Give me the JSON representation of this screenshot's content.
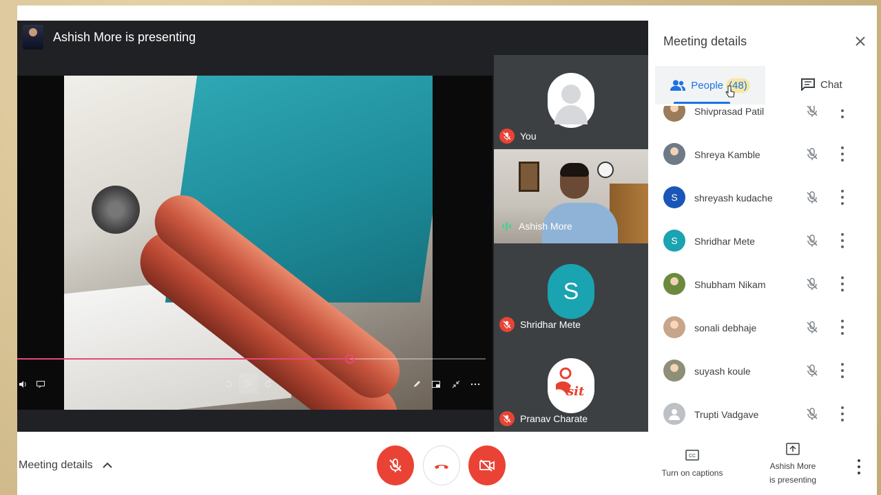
{
  "presentation": {
    "title": "Ashish More is presenting",
    "video": {
      "progress": 0.71
    }
  },
  "tiles": [
    {
      "name": "You",
      "muted": true,
      "type": "placeholder-avatar"
    },
    {
      "name": "Ashish More",
      "muted": false,
      "speaking": true,
      "type": "camera"
    },
    {
      "name": "Shridhar Mete",
      "muted": true,
      "type": "initial",
      "initial": "S",
      "color": "#1aa3b0"
    },
    {
      "name": "Pranav Charate",
      "muted": true,
      "type": "logo",
      "logo_text": "sit"
    }
  ],
  "panel": {
    "title": "Meeting details",
    "tabs": {
      "people_label": "People",
      "people_count": "(48)",
      "chat_label": "Chat"
    },
    "people": [
      {
        "name": "Shivprasad Patil",
        "avatar": "photo",
        "color": "#9a7b5a"
      },
      {
        "name": "Shreya Kamble",
        "avatar": "photo",
        "color": "#6f7a87"
      },
      {
        "name": "shreyash kudache",
        "avatar": "initial",
        "initial": "S",
        "color": "#1a56b8"
      },
      {
        "name": "Shridhar Mete",
        "avatar": "initial",
        "initial": "S",
        "color": "#1aa3b0"
      },
      {
        "name": "Shubham Nikam",
        "avatar": "photo",
        "color": "#6b8a3e"
      },
      {
        "name": "sonali debhaje",
        "avatar": "photo",
        "color": "#c7a58a"
      },
      {
        "name": "suyash koule",
        "avatar": "photo",
        "color": "#8d8f76"
      },
      {
        "name": "Trupti Vadgave",
        "avatar": "default",
        "color": "#bdc1c6"
      }
    ]
  },
  "bottom": {
    "meeting_details": "Meeting details",
    "captions_label": "Turn on captions",
    "present_label_1": "Ashish More",
    "present_label_2": "is presenting"
  },
  "colors": {
    "red": "#ea4335",
    "accent_blue": "#1a73e8",
    "progress_pink": "#e6477a",
    "stage_bg": "#202124",
    "tile_bg": "#3c4043"
  }
}
